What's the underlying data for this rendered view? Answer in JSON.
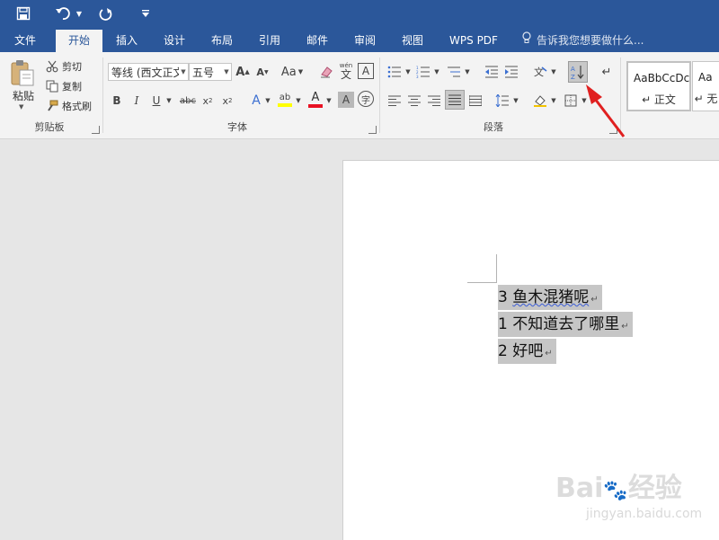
{
  "quick_access": {
    "save": "save-icon",
    "undo": "undo-icon",
    "redo": "redo-icon",
    "customize": "customize-qat-icon"
  },
  "tabs": [
    {
      "label": "文件"
    },
    {
      "label": "开始",
      "active": true
    },
    {
      "label": "插入"
    },
    {
      "label": "设计"
    },
    {
      "label": "布局"
    },
    {
      "label": "引用"
    },
    {
      "label": "邮件"
    },
    {
      "label": "审阅"
    },
    {
      "label": "视图"
    },
    {
      "label": "WPS PDF"
    }
  ],
  "tell_me": "告诉我您想要做什么...",
  "clipboard": {
    "paste": "粘贴",
    "cut": "剪切",
    "copy": "复制",
    "format_painter": "格式刷",
    "group": "剪贴板"
  },
  "font": {
    "name": "等线 (西文正文",
    "size": "五号",
    "group": "字体",
    "case": "Aa",
    "phonetic": "wén"
  },
  "paragraph": {
    "group": "段落"
  },
  "styles": {
    "items": [
      {
        "sample": "AaBbCcDc",
        "name": "↵ 正文"
      },
      {
        "sample": "Aa",
        "name": "↵ 无"
      }
    ]
  },
  "document": {
    "lines": [
      {
        "number": "3",
        "text": "鱼木混猪呢"
      },
      {
        "number": "1",
        "text": "不知道去了哪里"
      },
      {
        "number": "2",
        "text": "好吧"
      }
    ],
    "paragraph_mark": "↵"
  },
  "watermark": {
    "brand": "Bai",
    "brand2": "经验",
    "url": "jingyan.baidu.com"
  },
  "colors": {
    "accent": "#2b579a",
    "arrow": "#e02020",
    "highlight": "#c6c6c6",
    "highlight_yellow": "#ffff00",
    "font_color_red": "#e81123"
  }
}
